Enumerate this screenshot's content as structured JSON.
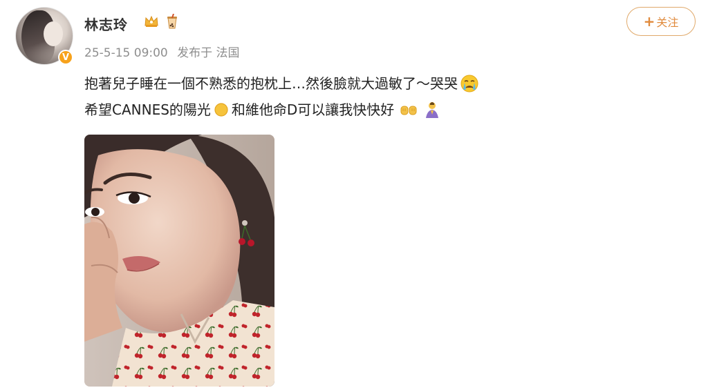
{
  "user": {
    "name": "林志玲",
    "badges": [
      "crown-icon",
      "bubble-tea-icon"
    ],
    "verified_badge": "V"
  },
  "post": {
    "date": "25-5-15 09:00",
    "source": "发布于 法国",
    "line1": "抱著兒子睡在一個不熟悉的抱枕上…然後臉就大過敏了～哭哭",
    "line2_a": "希望CANNES的陽光",
    "line2_b": "和維他命D可以讓我快快好",
    "emojis": [
      "crying-face-icon",
      "sun-icon",
      "fists-icon",
      "praying-person-icon"
    ]
  },
  "actions": {
    "follow_plus": "+",
    "follow_label": "关注"
  },
  "colors": {
    "accent": "#e08a3c",
    "accent_border": "#e0a96a",
    "verified": "#f7a21b",
    "meta_text": "#8e8e8e"
  }
}
